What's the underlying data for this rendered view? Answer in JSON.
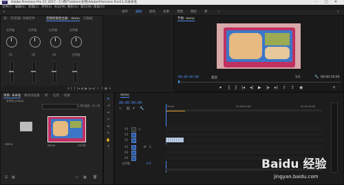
{
  "window": {
    "title": "Adobe Premiere Pro CC 2017 - C:\\用户\\admin\\文档\\Adobe\\Premiere Pro\\11.0\\未命名"
  },
  "menu": [
    "文件(F)",
    "编辑(E)",
    "剪辑(C)",
    "序列(S)",
    "标记(M)",
    "图形(G)",
    "窗口(W)",
    "帮助(H)"
  ],
  "workspaces": [
    "组件",
    "编辑",
    "颜色",
    "效果",
    "音频",
    "图形",
    "库"
  ],
  "source_panel": {
    "tabs": [
      "源：(无剪辑)",
      "效果控件",
      "音频剪辑混合器：demo",
      "元数据"
    ],
    "mixer_labels": [
      "左声道",
      "左声道",
      "左声道",
      "左声道"
    ],
    "channels": [
      "A1",
      "A2",
      "A3",
      "主声道"
    ],
    "timecode": "00:00:00:00"
  },
  "program_panel": {
    "tab": "节目: demo",
    "tab_label": "节目: demo",
    "timecode_left": "00:00:00:00",
    "fit": "适合",
    "ratio": "1/2",
    "timecode_right": "00:00:10:00"
  },
  "project_panel": {
    "tabs": [
      "项目: 未命名",
      "媒体浏览器",
      "库",
      "信息",
      "效果"
    ],
    "path": "未命名.prproj",
    "search_placeholder": "",
    "item_count": "1 项已选择，共 2 项",
    "items": [
      {
        "name": "demo",
        "duration": "10:00"
      },
      {
        "name": "demo",
        "duration": "10:00"
      }
    ]
  },
  "timeline": {
    "tab": "demo",
    "timecode": "00:00:00:00",
    "ruler": [
      "00:00",
      "00:00:05:00",
      "00:00:10:00"
    ],
    "video_tracks": [
      "V3",
      "V2",
      "V1"
    ],
    "audio_tracks": [
      "A1",
      "A2",
      "A3"
    ],
    "master": "主声道",
    "master_value": "0.0"
  },
  "watermark": {
    "brand": "Baidu 经验",
    "url": "jingyan.baidu.com"
  },
  "colors": {
    "accent": "#4e8ff3",
    "bg": "#1d1d1d",
    "panel": "#232323"
  }
}
